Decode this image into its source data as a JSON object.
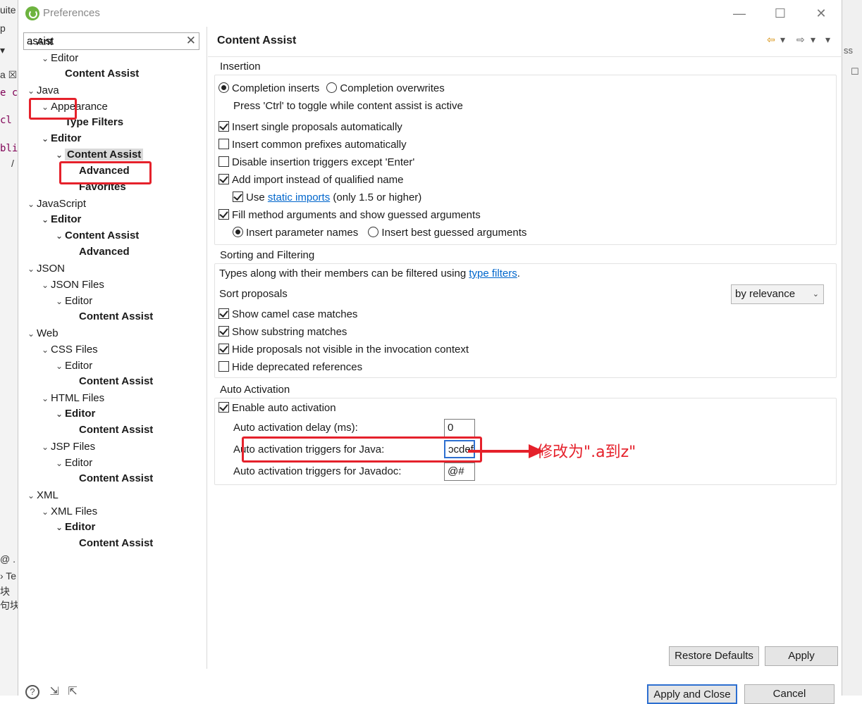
{
  "window": {
    "title": "Preferences",
    "minimize": "—",
    "maximize": "☐",
    "close": "✕"
  },
  "search": {
    "value": "assist",
    "clear": "✕"
  },
  "tree": [
    {
      "label": "Ant",
      "chev": "⌄",
      "bold": false
    },
    {
      "label": "Editor",
      "chev": "⌄",
      "bold": false
    },
    {
      "label": "Content Assist",
      "chev": "",
      "bold": true
    },
    {
      "label": "Java",
      "chev": "⌄",
      "bold": false
    },
    {
      "label": "Appearance",
      "chev": "⌄",
      "bold": false
    },
    {
      "label": "Type Filters",
      "chev": "",
      "bold": true
    },
    {
      "label": "Editor",
      "chev": "⌄",
      "bold": true
    },
    {
      "label": "Content Assist",
      "chev": "⌄",
      "bold": true,
      "selected": true
    },
    {
      "label": "Advanced",
      "chev": "",
      "bold": true
    },
    {
      "label": "Favorites",
      "chev": "",
      "bold": true
    },
    {
      "label": "JavaScript",
      "chev": "⌄",
      "bold": false
    },
    {
      "label": "Editor",
      "chev": "⌄",
      "bold": true
    },
    {
      "label": "Content Assist",
      "chev": "⌄",
      "bold": true
    },
    {
      "label": "Advanced",
      "chev": "",
      "bold": true
    },
    {
      "label": "JSON",
      "chev": "⌄",
      "bold": false
    },
    {
      "label": "JSON Files",
      "chev": "⌄",
      "bold": false
    },
    {
      "label": "Editor",
      "chev": "⌄",
      "bold": false
    },
    {
      "label": "Content Assist",
      "chev": "",
      "bold": true
    },
    {
      "label": "Web",
      "chev": "⌄",
      "bold": false
    },
    {
      "label": "CSS Files",
      "chev": "⌄",
      "bold": false
    },
    {
      "label": "Editor",
      "chev": "⌄",
      "bold": false
    },
    {
      "label": "Content Assist",
      "chev": "",
      "bold": true
    },
    {
      "label": "HTML Files",
      "chev": "⌄",
      "bold": false
    },
    {
      "label": "Editor",
      "chev": "⌄",
      "bold": true
    },
    {
      "label": "Content Assist",
      "chev": "",
      "bold": true
    },
    {
      "label": "JSP Files",
      "chev": "⌄",
      "bold": false
    },
    {
      "label": "Editor",
      "chev": "⌄",
      "bold": false
    },
    {
      "label": "Content Assist",
      "chev": "",
      "bold": true
    },
    {
      "label": "XML",
      "chev": "⌄",
      "bold": false
    },
    {
      "label": "XML Files",
      "chev": "⌄",
      "bold": false
    },
    {
      "label": "Editor",
      "chev": "⌄",
      "bold": true
    },
    {
      "label": "Content Assist",
      "chev": "",
      "bold": true
    }
  ],
  "page": {
    "title": "Content Assist",
    "nav_back": "⇦",
    "nav_forward": "⇨",
    "nav_menu": "▾"
  },
  "insertion": {
    "title": "Insertion",
    "completion_inserts": "Completion inserts",
    "completion_overwrites": "Completion overwrites",
    "toggle_hint": "Press 'Ctrl' to toggle while content assist is active",
    "insert_single": "Insert single proposals automatically",
    "insert_common": "Insert common prefixes automatically",
    "disable_triggers": "Disable insertion triggers except 'Enter'",
    "add_import": "Add import instead of qualified name",
    "use_prefix": "Use",
    "static_imports": "static imports",
    "static_suffix": "(only 1.5 or higher)",
    "fill_args": "Fill method arguments and show guessed arguments",
    "insert_param_names": "Insert parameter names",
    "insert_best_guessed": "Insert best guessed arguments"
  },
  "sorting": {
    "title": "Sorting and Filtering",
    "types_prefix": "Types along with their members can be filtered using",
    "type_filters": "type filters",
    "types_suffix": ".",
    "sort_proposals": "Sort proposals",
    "sort_value": "by relevance",
    "show_camel": "Show camel case matches",
    "show_substring": "Show substring matches",
    "hide_not_visible": "Hide proposals not visible in the invocation context",
    "hide_deprecated": "Hide deprecated references"
  },
  "auto_activation": {
    "title": "Auto Activation",
    "enable": "Enable auto activation",
    "delay_label": "Auto activation delay (ms):",
    "delay_value": "0",
    "java_label": "Auto activation triggers for Java:",
    "java_value": "ɔcdef",
    "javadoc_label": "Auto activation triggers for Javadoc:",
    "javadoc_value": "@#"
  },
  "annotation": {
    "text": "修改为\".a到z\"",
    "color": "#e5212b"
  },
  "buttons": {
    "restore_defaults": "Restore Defaults",
    "apply": "Apply",
    "apply_close": "Apply and Close",
    "cancel": "Cancel"
  },
  "footer": {
    "help_icon": "?",
    "import_icon": "⇲",
    "export_icon": "⇱"
  },
  "background": {
    "left": [
      "uite",
      "p",
      "▾",
      "a ☒",
      "e c",
      "cl",
      "bli",
      "/",
      "@ .",
      "› Te",
      "块",
      "句块"
    ],
    "right": [
      "ss",
      "☐"
    ]
  }
}
